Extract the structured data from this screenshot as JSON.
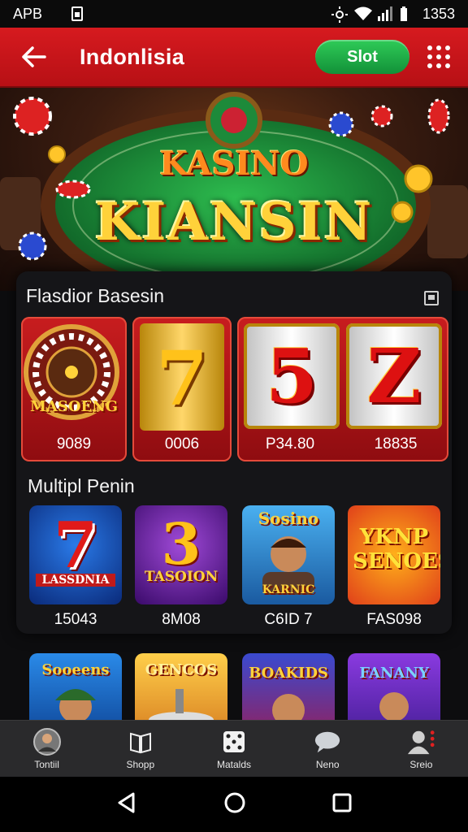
{
  "status_bar": {
    "left_text": "APB",
    "carrier_icon": "sim-icon",
    "time": "1353"
  },
  "app_bar": {
    "title": "Indonlisia",
    "slot_label": "Slot"
  },
  "hero": {
    "line1": "KASINO",
    "line2": "KIANSIN"
  },
  "featured": {
    "title": "Flasdior Basesin",
    "cards": [
      {
        "art_text": "MASOENG",
        "value": "9089"
      },
      {
        "art_text": "7",
        "value": "0006"
      },
      {
        "art_text": "5",
        "value": "P34.80"
      },
      {
        "art_text": "Z",
        "value": "18835"
      }
    ]
  },
  "multi": {
    "title": "Multipl Penin",
    "games": [
      {
        "art_text": "LASSDNIA",
        "value": "15043"
      },
      {
        "art_text": "TASOION",
        "value": "8M08"
      },
      {
        "art_text": "KARNIC",
        "value": "C6ID 7"
      },
      {
        "art_text": "YKNP SENOES",
        "value": "FAS098"
      }
    ],
    "row2": [
      {
        "art_text": "Sooeens"
      },
      {
        "art_text": "GENCOS"
      },
      {
        "art_text": "BOAKIDS"
      },
      {
        "art_text": "FANANY"
      }
    ]
  },
  "bottom_nav": [
    {
      "label": "Tontiil",
      "icon": "avatar-icon"
    },
    {
      "label": "Shopp",
      "icon": "book-icon"
    },
    {
      "label": "Matalds",
      "icon": "dice-icon"
    },
    {
      "label": "Neno",
      "icon": "chat-icon"
    },
    {
      "label": "Sreio",
      "icon": "profile-icon"
    }
  ],
  "colors": {
    "primary_red": "#d61a1f",
    "slot_green": "#2fcb58",
    "table_green": "#1d8a3a"
  }
}
